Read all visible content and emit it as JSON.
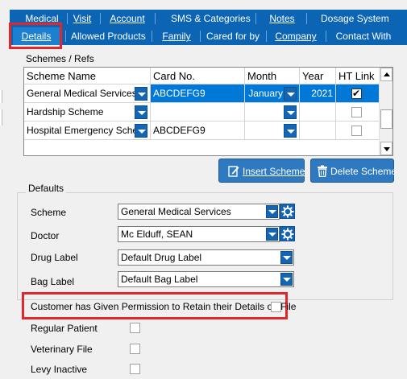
{
  "tabs_row1": [
    {
      "label": "Medical",
      "shortcut": null
    },
    {
      "label": "Visit",
      "shortcut": "V"
    },
    {
      "label": "Account",
      "shortcut": "A"
    },
    {
      "label": "SMS & Categories",
      "shortcut": null
    },
    {
      "label": "Notes",
      "shortcut": "N"
    },
    {
      "label": "Dosage System",
      "shortcut": "S"
    }
  ],
  "tabs_row2": [
    {
      "label": "Details",
      "shortcut": "D",
      "active": true
    },
    {
      "label": "Allowed Products",
      "shortcut": null
    },
    {
      "label": "Family",
      "shortcut": "F"
    },
    {
      "label": "Cared for by",
      "shortcut": "b"
    },
    {
      "label": "Company",
      "shortcut": "p"
    },
    {
      "label": "Contact With",
      "shortcut": "t"
    }
  ],
  "schemes": {
    "title": "Schemes / Refs",
    "columns": [
      "Scheme Name",
      "Card No.",
      "Month",
      "Year",
      "HT Link"
    ],
    "rows": [
      {
        "scheme": "General Medical Services",
        "card": "ABCDEFG9",
        "month": "January",
        "year": "2021",
        "ht_link": true,
        "selected": true
      },
      {
        "scheme": "Hardship Scheme",
        "card": "",
        "month": "",
        "year": "",
        "ht_link": false,
        "selected": false
      },
      {
        "scheme": "Hospital Emergency Scheme",
        "card": "ABCDEFG9",
        "month": "",
        "year": "",
        "ht_link": false,
        "selected": false
      }
    ]
  },
  "actions": {
    "insert_label": "Insert Scheme",
    "delete_label": "Delete Scheme"
  },
  "defaults": {
    "title": "Defaults",
    "scheme_label": "Scheme",
    "scheme_value": "General Medical Services",
    "doctor_label": "Doctor",
    "doctor_value": "Mc Elduff, SEAN",
    "drug_label_label": "Drug Label",
    "drug_label_value": "Default Drug Label",
    "bag_label_label": "Bag Label",
    "bag_label_value": "Default Bag Label"
  },
  "checkboxes": [
    {
      "label": "Customer has Given Permission to Retain their Details on File",
      "checked": false
    },
    {
      "label": "Regular Patient",
      "checked": false
    },
    {
      "label": "Veterinary File",
      "checked": false
    },
    {
      "label": "Levy Inactive",
      "checked": false
    }
  ],
  "colors": {
    "tab_bar": "#0c64b4",
    "highlight_box": "#e2262b",
    "selected_row": "#0078d7",
    "button": "#2e79c0"
  }
}
